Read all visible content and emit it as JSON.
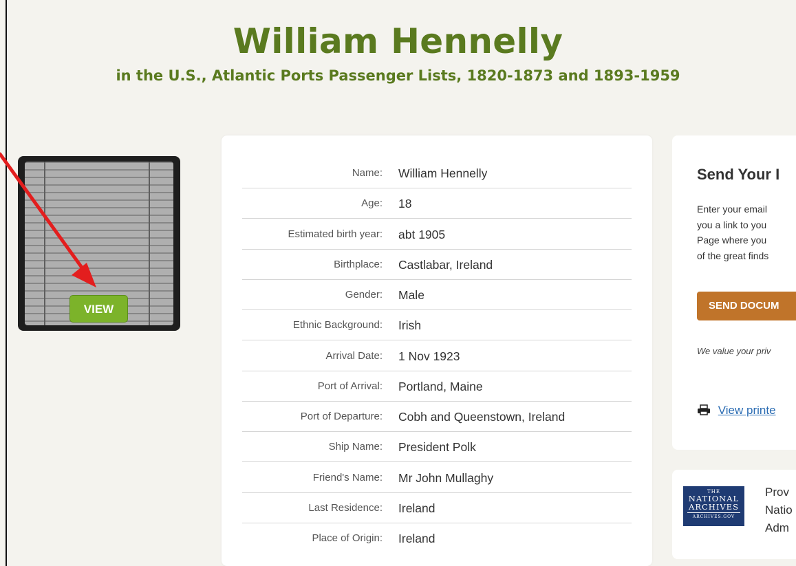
{
  "header": {
    "title": "William Hennelly",
    "subtitle": "in the U.S., Atlantic Ports Passenger Lists, 1820-1873 and 1893-1959"
  },
  "thumbnail": {
    "view_label": "VIEW"
  },
  "record": {
    "rows": [
      {
        "label": "Name:",
        "value": "William Hennelly"
      },
      {
        "label": "Age:",
        "value": "18"
      },
      {
        "label": "Estimated birth year:",
        "value": "abt 1905"
      },
      {
        "label": "Birthplace:",
        "value": "Castlabar, Ireland"
      },
      {
        "label": "Gender:",
        "value": "Male"
      },
      {
        "label": "Ethnic Background:",
        "value": "Irish"
      },
      {
        "label": "Arrival Date:",
        "value": "1 Nov 1923"
      },
      {
        "label": "Port of Arrival:",
        "value": "Portland, Maine"
      },
      {
        "label": "Port of Departure:",
        "value": "Cobh and Queenstown, Ireland"
      },
      {
        "label": "Ship Name:",
        "value": "President Polk"
      },
      {
        "label": "Friend's Name:",
        "value": "Mr John Mullaghy"
      },
      {
        "label": "Last Residence:",
        "value": "Ireland"
      },
      {
        "label": "Place of Origin:",
        "value": "Ireland"
      }
    ]
  },
  "sidebar": {
    "title": "Send Your I",
    "text_lines": [
      "Enter your email",
      "you a link to you",
      "Page where you",
      "of the great finds"
    ],
    "send_label": "SEND DOCUM",
    "privacy": "We value your priv",
    "print_icon": "printer-icon",
    "print_link": "View printe"
  },
  "provider": {
    "logo": {
      "line1": "THE",
      "line2": "NATIONAL",
      "line3": "ARCHIVES",
      "line4": "ARCHIVES.GOV"
    },
    "text_lines": [
      "Prov",
      "Natio",
      "Adm"
    ]
  },
  "colors": {
    "title_green": "#5a7a1f",
    "view_button": "#7cb32a",
    "send_button": "#c0742a",
    "link_blue": "#2b6cb3",
    "annotation_arrow": "#e31e1e"
  }
}
